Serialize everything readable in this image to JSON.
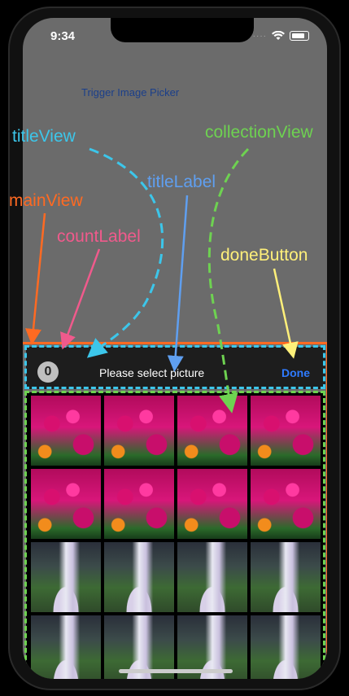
{
  "status_bar": {
    "time": "9:34",
    "signal": "····",
    "wifi_icon": "wifi-icon",
    "battery_icon": "battery-icon"
  },
  "trigger_button": "Trigger Image Picker",
  "annotations": {
    "titleView": "titleView",
    "collectionView": "collectionView",
    "titleLabel": "titleLabel",
    "mainView": "mainView",
    "countLabel": "countLabel",
    "doneButton": "doneButton"
  },
  "annotation_colors": {
    "titleView": "#3cc6ea",
    "collectionView": "#6ed251",
    "titleLabel": "#5f9ff0",
    "mainView": "#ff6a22",
    "countLabel": "#f05a8c",
    "doneButton": "#fff07a"
  },
  "picker": {
    "count": "0",
    "title": "Please select picture",
    "done": "Done",
    "thumbnails": [
      "flower",
      "flower",
      "flower",
      "flower",
      "flower",
      "flower",
      "flower",
      "flower",
      "waterfall",
      "waterfall",
      "waterfall",
      "waterfall",
      "waterfall",
      "waterfall",
      "waterfall",
      "waterfall"
    ]
  }
}
